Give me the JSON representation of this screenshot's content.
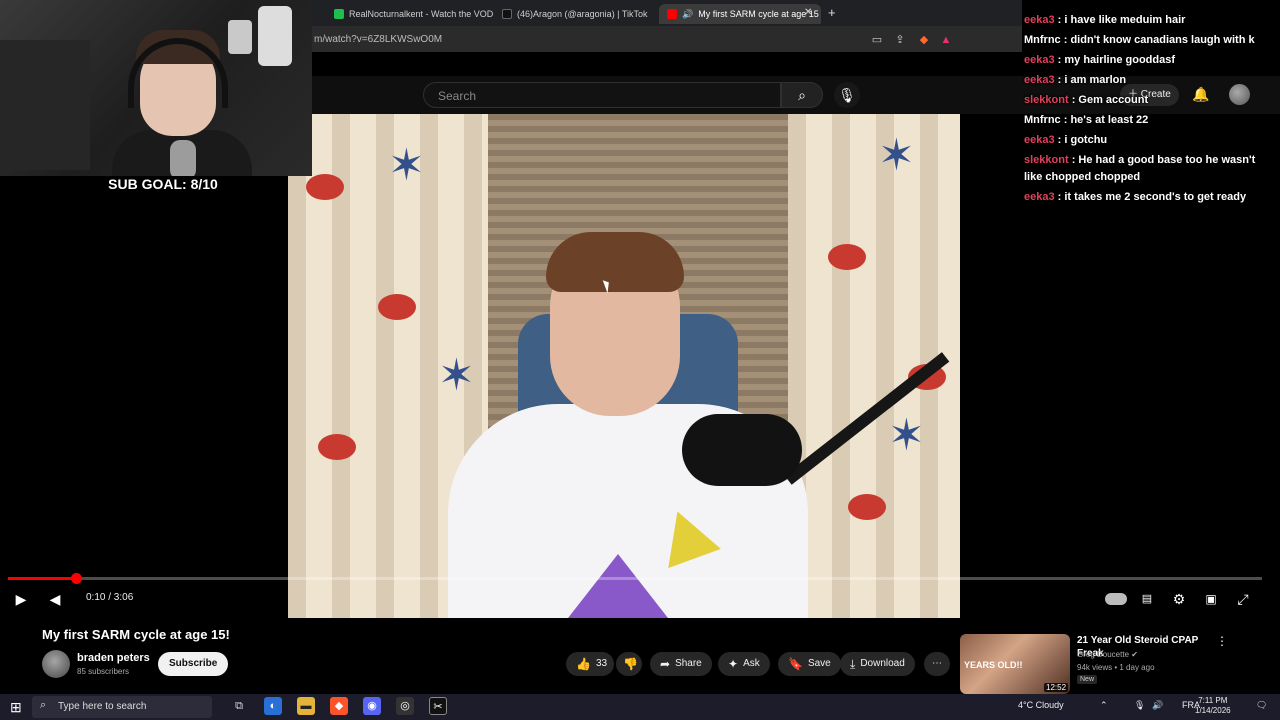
{
  "browser": {
    "tabs": [
      {
        "label": "RealNocturnalkent - Watch the VOD",
        "active": false
      },
      {
        "label": "(46)Aragon (@aragonia) | TikTok",
        "active": false
      },
      {
        "label": "My first SARM cycle at age 15",
        "active": true
      }
    ],
    "url": "m/watch?v=6Z8LKWSwO0M"
  },
  "stream_overlay": {
    "sub_goal": "SUB GOAL: 8/10",
    "chat": [
      {
        "user": "eeka3",
        "message": "i have like meduim hair"
      },
      {
        "user": "Mnfrnc",
        "message": "didn't know canadians laugh with k"
      },
      {
        "user": "eeka3",
        "message": "my hairline gooddasf"
      },
      {
        "user": "eeka3",
        "message": "i am marlon"
      },
      {
        "user": "slekkont",
        "message": "Gem account"
      },
      {
        "user": "Mnfrnc",
        "message": "he's at least 22"
      },
      {
        "user": "eeka3",
        "message": "i gotchu"
      },
      {
        "user": "slekkont",
        "message": "He had a good base too he wasn't like chopped chopped"
      },
      {
        "user": "eeka3",
        "message": "it takes me 2 second's to get ready"
      }
    ]
  },
  "header": {
    "search_placeholder": "Search",
    "create_label": "Create"
  },
  "player": {
    "time": "0:10 / 3:06",
    "progress": 0.054
  },
  "video": {
    "title": "My first SARM cycle at age 15!",
    "channel": "braden peters",
    "subscribers": "85 subscribers",
    "subscribe_label": "Subscribe",
    "likes": "33",
    "share_label": "Share",
    "ask_label": "Ask",
    "save_label": "Save",
    "download_label": "Download"
  },
  "recommended": {
    "title": "21 Year Old Steroid CPAP Freak",
    "channel": "Greg Doucette",
    "meta": "94k views • 1 day ago",
    "badge": "New",
    "duration": "12:52",
    "thumb_text": "YEARS OLD!!"
  },
  "taskbar": {
    "search_placeholder": "Type here to search",
    "weather": "4°C  Cloudy",
    "lang": "FRA",
    "time": "7:11 PM",
    "date": "1/14/2026"
  },
  "colors": {
    "accent_red": "#ff0000",
    "chat_user": "#e0405a"
  }
}
